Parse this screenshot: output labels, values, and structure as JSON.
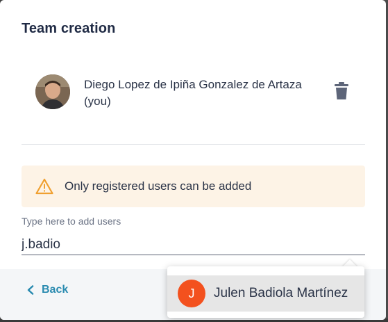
{
  "dialog": {
    "title": "Team creation"
  },
  "member": {
    "name": "Diego Lopez de Ipiña Gonzalez de Artaza",
    "you_tag": "(you)",
    "avatar_icon": "user-photo",
    "remove_icon": "trash-icon"
  },
  "warning": {
    "icon": "warning-triangle-icon",
    "text": "Only registered users can be added",
    "bg_color": "#fdf3e6",
    "icon_color": "#f0a030"
  },
  "add_users": {
    "placeholder": "Type here to add users",
    "value": "j.badio"
  },
  "footer": {
    "back_label": "Back",
    "back_icon": "chevron-left-icon",
    "accent_color": "#2a8bb0"
  },
  "suggestions": [
    {
      "initial": "J",
      "name": "Julen Badiola Martínez",
      "avatar_color": "#f3511e"
    }
  ]
}
